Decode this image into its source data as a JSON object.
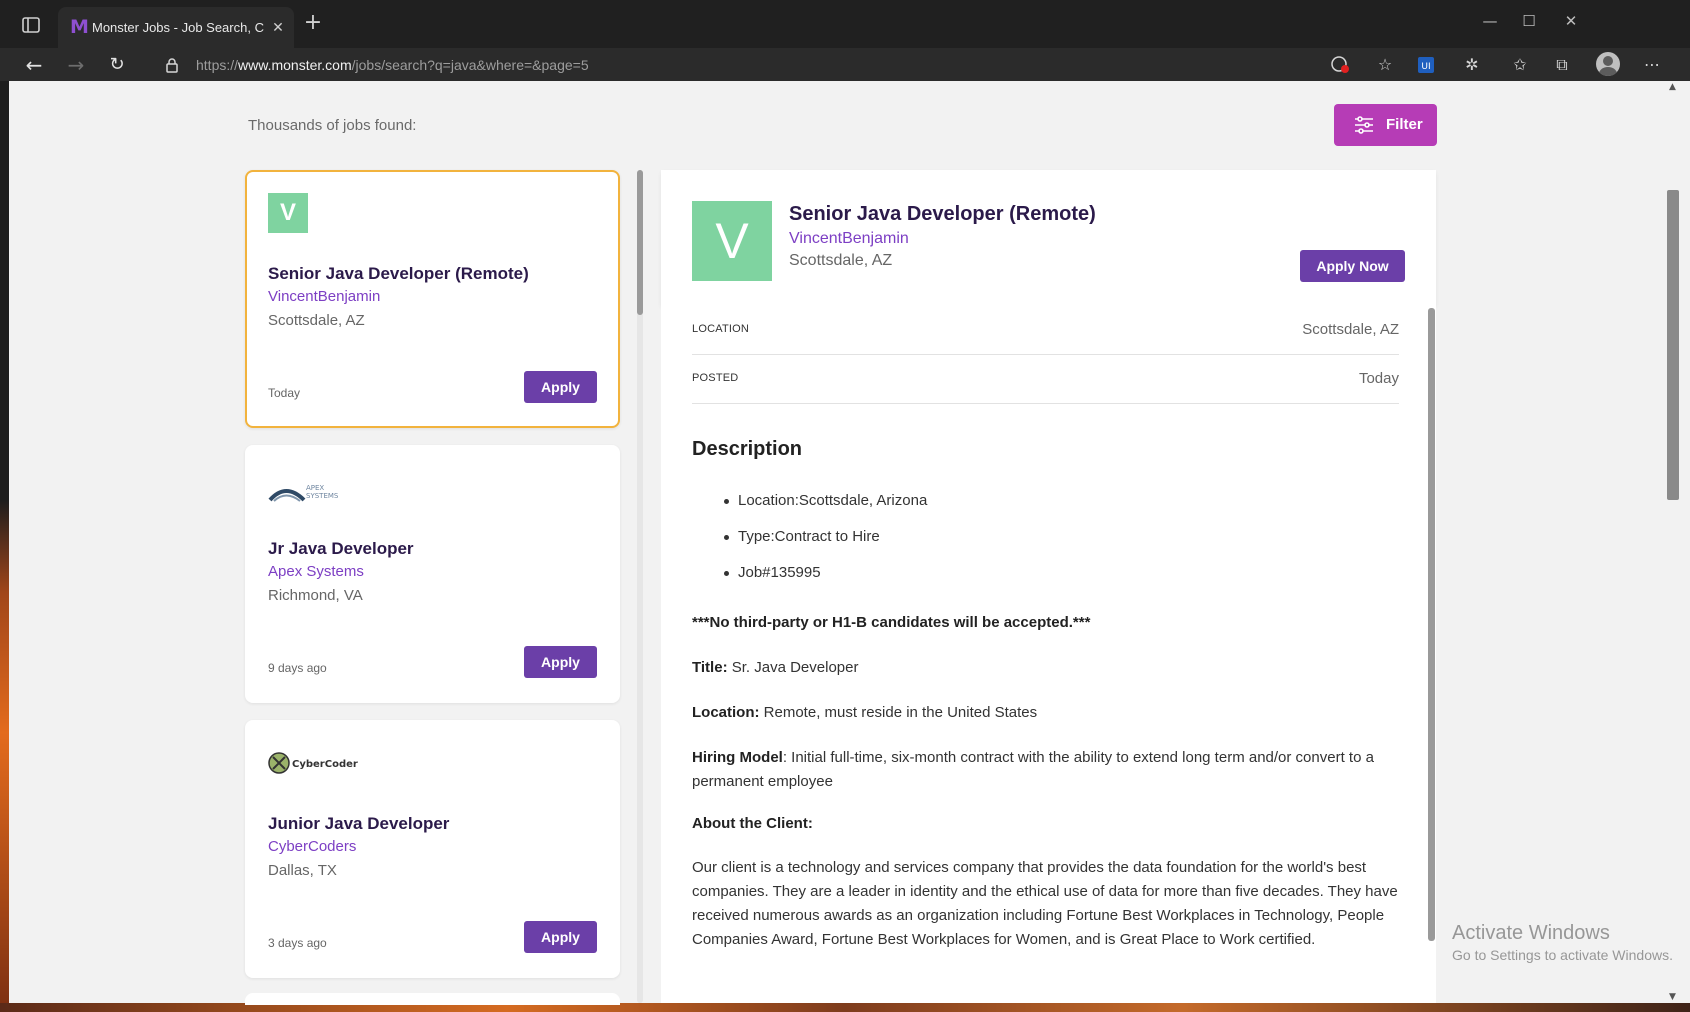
{
  "browser": {
    "tab_title": "Monster Jobs - Job Search, Career",
    "tab_favicon": "M",
    "url_prefix": "https://",
    "url_host": "www.monster.com",
    "url_path": "/jobs/search?q=java&where=&page=5"
  },
  "page": {
    "results_count": "Thousands of jobs found:",
    "filter_label": "Filter"
  },
  "jobs": [
    {
      "logo_letter": "V",
      "title": "Senior Java Developer (Remote)",
      "company": "VincentBenjamin",
      "location": "Scottsdale, AZ",
      "posted": "Today",
      "apply_label": "Apply",
      "selected": true
    },
    {
      "logo_text": "APEX SYSTEMS",
      "title": "Jr Java Developer",
      "company": "Apex Systems",
      "location": "Richmond, VA",
      "posted": "9 days ago",
      "apply_label": "Apply"
    },
    {
      "logo_text": "CyberCoders.",
      "title": "Junior Java Developer",
      "company": "CyberCoders",
      "location": "Dallas, TX",
      "posted": "3 days ago",
      "apply_label": "Apply"
    }
  ],
  "detail": {
    "logo_letter": "V",
    "title": "Senior Java Developer (Remote)",
    "company": "VincentBenjamin",
    "location": "Scottsdale, AZ",
    "apply_now_label": "Apply Now",
    "location_label": "LOCATION",
    "location_value": "Scottsdale, AZ",
    "posted_label": "POSTED",
    "posted_value": "Today",
    "description_heading": "Description",
    "bullets": [
      "Location:Scottsdale, Arizona",
      "Type:Contract to Hire",
      "Job#135995"
    ],
    "notice": "***No third-party or H1-B candidates will be accepted.***",
    "title_label": "Title:",
    "title_value": " Sr. Java Developer",
    "location2_label": "Location:",
    "location2_value": " Remote, must reside in the United States",
    "hiring_label": "Hiring Model",
    "hiring_value": ": Initial full-time, six-month contract with the ability to extend long term and/or convert to a permanent employee",
    "about_heading": "About the Client:",
    "about_text": "Our client is a technology and services company that provides the data foundation for the world's best companies. They are a leader in identity and the ethical use of data for more than five decades. They have received numerous awards as an organization including Fortune Best Workplaces in Technology, People Companies Award, Fortune Best Workplaces for Women, and is Great Place to Work certified."
  },
  "watermark": {
    "title": "Activate Windows",
    "subtitle": "Go to Settings to activate Windows."
  }
}
